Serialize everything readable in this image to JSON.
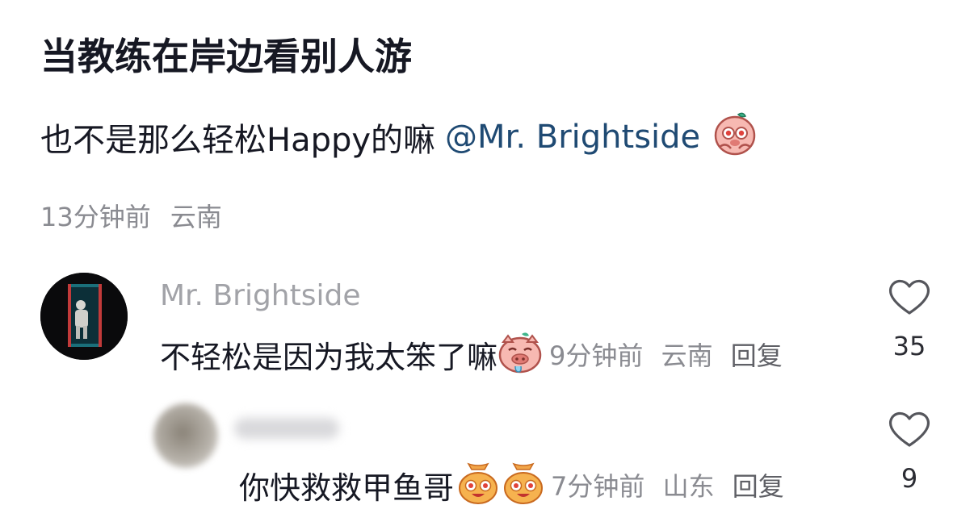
{
  "post": {
    "title": "当教练在岸边看别人游",
    "body_text": "也不是那么轻松Happy的嘛",
    "mention": "@Mr. Brightside",
    "body_emoji": "pig-shy-emoji",
    "time": "13分钟前",
    "location": "云南"
  },
  "comments": [
    {
      "author": "Mr. Brightside",
      "avatar": "astronaut-door-avatar",
      "text": "不轻松是因为我太笨了嘛",
      "emoji": "pig-drool-emoji",
      "time": "9分钟前",
      "location": "云南",
      "reply_label": "回复",
      "likes": "35"
    },
    {
      "author": "",
      "avatar": "blurred-avatar",
      "text": "你快救救甲鱼哥",
      "emoji": "money-bag-face-emoji",
      "time": "7分钟前",
      "location": "山东",
      "reply_label": "回复",
      "likes": "9"
    }
  ],
  "icons": {
    "like": "heart-outline-icon"
  },
  "colors": {
    "mention": "#1f4a73",
    "meta": "#8a8b91",
    "text": "#161823"
  }
}
